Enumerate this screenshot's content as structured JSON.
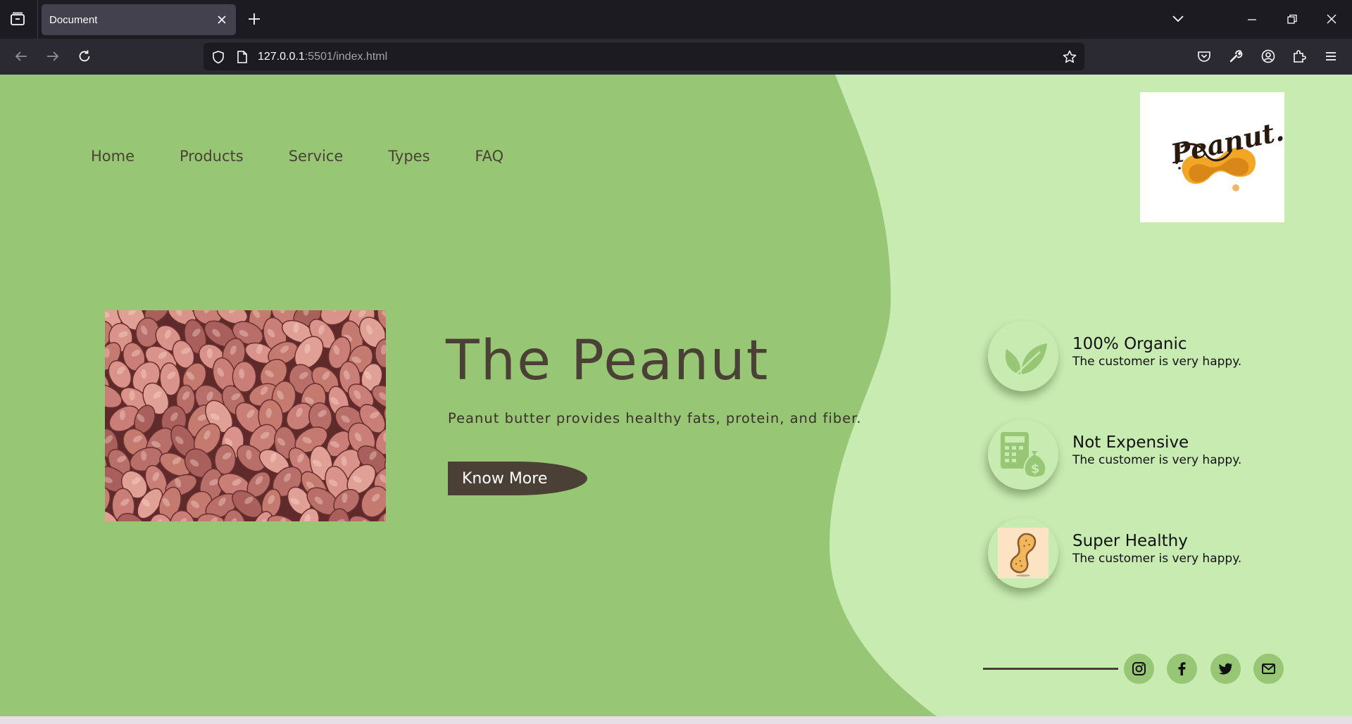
{
  "browser": {
    "tab_title": "Document",
    "url_host": "127.0.0.1",
    "url_rest": ":5501/index.html"
  },
  "nav": {
    "items": [
      "Home",
      "Products",
      "Service",
      "Types",
      "FAQ"
    ]
  },
  "logo": {
    "text": "Peanut."
  },
  "hero": {
    "title": "The Peanut",
    "subtitle": "Peanut butter provides healthy fats, protein, and fiber.",
    "button_label": "Know More"
  },
  "features": [
    {
      "title": "100% Organic",
      "desc": "The customer is very happy.",
      "icon": "leaf-icon"
    },
    {
      "title": "Not Expensive",
      "desc": "The customer is very happy.",
      "icon": "money-bag-icon"
    },
    {
      "title": "Super Healthy",
      "desc": "The customer is very happy.",
      "icon": "peanut-icon"
    }
  ],
  "social": [
    "instagram-icon",
    "facebook-icon",
    "twitter-icon",
    "mail-icon"
  ],
  "colors": {
    "dark_green": "#97c674",
    "light_green": "#c8ebb2",
    "brown": "#4b4036",
    "chrome_dark": "#1c1b22",
    "chrome_mid": "#2b2a33"
  }
}
